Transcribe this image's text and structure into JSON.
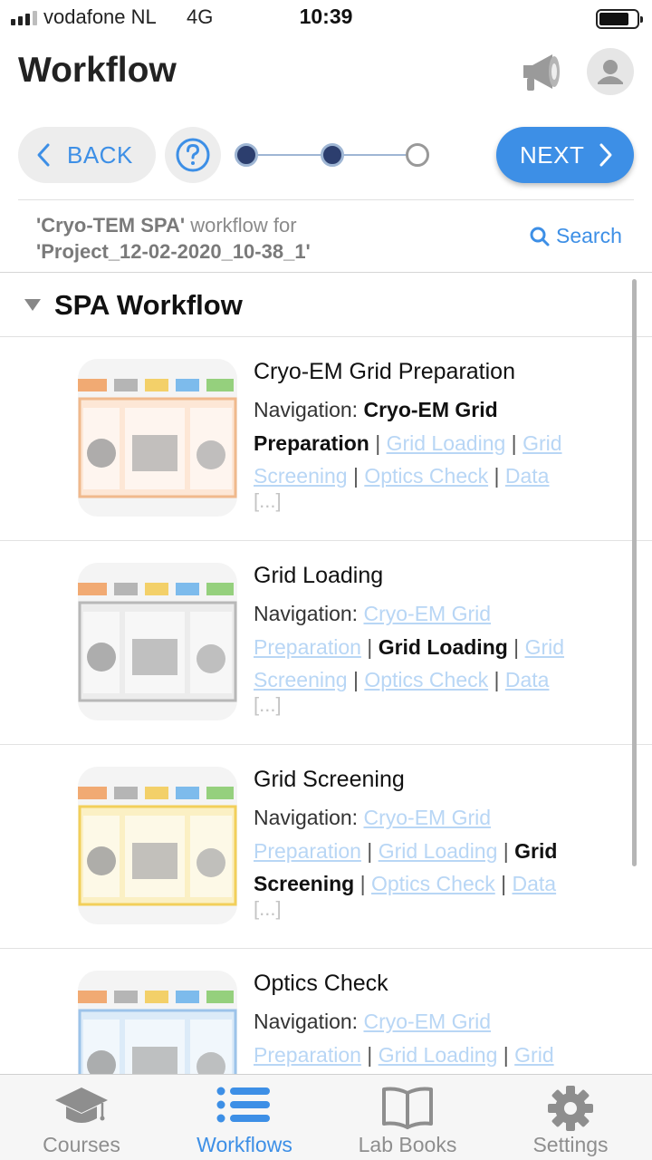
{
  "status_bar": {
    "carrier": "vodafone NL",
    "network": "4G",
    "time": "10:39",
    "signal_bars": 4,
    "signal_active": 3,
    "battery_level": 0.8
  },
  "header": {
    "title": "Workflow",
    "icons": [
      "megaphone-icon",
      "user-avatar-icon"
    ]
  },
  "toolbar": {
    "back_label": "BACK",
    "next_label": "NEXT",
    "help_icon": "question-circle-icon",
    "progress": {
      "steps": 3,
      "completed": 2
    }
  },
  "context": {
    "workflow_name": "'Cryo-TEM SPA'",
    "middle_text": " workflow for",
    "project_name": "'Project_12-02-2020_10-38_1'",
    "search_label": "Search"
  },
  "section": {
    "title": "SPA Workflow"
  },
  "nav_prefix": "Navigation: ",
  "ellipsis": "[...]",
  "items": [
    {
      "title": "Cryo-EM Grid Preparation",
      "thumb_accent": "#f0b98c",
      "thumb_bg": "#fde7d6",
      "nav": [
        {
          "text": "Cryo-EM Grid Preparation",
          "current": true
        },
        {
          "text": "Grid Loading",
          "current": false
        },
        {
          "text": "Grid Screening",
          "current": false
        },
        {
          "text": "Optics Check",
          "current": false
        },
        {
          "text": "Data",
          "current": false
        }
      ]
    },
    {
      "title": "Grid Loading",
      "thumb_accent": "#b8b8b8",
      "thumb_bg": "#ececec",
      "nav": [
        {
          "text": "Cryo-EM Grid Preparation",
          "current": false
        },
        {
          "text": "Grid Loading",
          "current": true
        },
        {
          "text": "Grid Screening",
          "current": false
        },
        {
          "text": "Optics Check",
          "current": false
        },
        {
          "text": "Data",
          "current": false
        }
      ]
    },
    {
      "title": "Grid Screening",
      "thumb_accent": "#f2cf5a",
      "thumb_bg": "#fbf0c4",
      "nav": [
        {
          "text": "Cryo-EM Grid Preparation",
          "current": false
        },
        {
          "text": "Grid Loading",
          "current": false
        },
        {
          "text": "Grid Screening",
          "current": true
        },
        {
          "text": "Optics Check",
          "current": false
        },
        {
          "text": "Data",
          "current": false
        }
      ]
    },
    {
      "title": "Optics Check",
      "thumb_accent": "#9cc3ea",
      "thumb_bg": "#dcebf8",
      "nav": [
        {
          "text": "Cryo-EM Grid Preparation",
          "current": false
        },
        {
          "text": "Grid Loading",
          "current": false
        },
        {
          "text": "Grid",
          "current": false
        }
      ]
    }
  ],
  "tabs": [
    {
      "label": "Courses",
      "icon": "graduation-cap-icon",
      "active": false
    },
    {
      "label": "Workflows",
      "icon": "list-icon",
      "active": true
    },
    {
      "label": "Lab Books",
      "icon": "book-icon",
      "active": false
    },
    {
      "label": "Settings",
      "icon": "gear-icon",
      "active": false
    }
  ],
  "colors": {
    "accent": "#3d8fe6",
    "link_faded": "#b8d6f5",
    "progress_done": "#2c3e6e"
  }
}
